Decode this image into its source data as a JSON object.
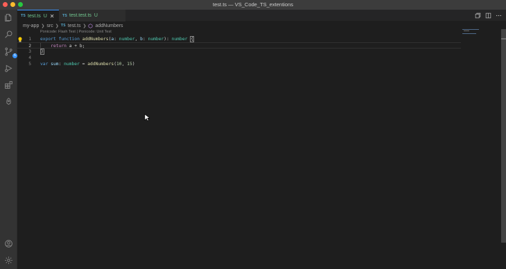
{
  "window": {
    "title": "test.ts — VS_Code_TS_extentions"
  },
  "activity_bar": {
    "items": [
      {
        "icon": "files-icon"
      },
      {
        "icon": "search-icon"
      },
      {
        "icon": "source-control-icon",
        "badge": "6"
      },
      {
        "icon": "run-debug-icon"
      },
      {
        "icon": "extensions-icon"
      },
      {
        "icon": "ponicode-icon"
      }
    ],
    "bottom_items": [
      {
        "icon": "account-icon"
      },
      {
        "icon": "settings-gear-icon"
      }
    ]
  },
  "tabs": [
    {
      "lang": "TS",
      "name": "test.ts",
      "status": "U",
      "active": true,
      "close": "✕"
    },
    {
      "lang": "TS",
      "name": "test.test.ts",
      "status": "U",
      "active": false
    }
  ],
  "breadcrumb": {
    "items": [
      "my-app",
      "src",
      "test.ts",
      "addNumbers"
    ],
    "ts_badge": "TS"
  },
  "editor": {
    "codelens": "Ponicode: Flash Test | Ponicode: Unit Test",
    "line_numbers": [
      "1",
      "2",
      "3",
      "4",
      "5"
    ],
    "active_line": "2",
    "lines": {
      "l1": {
        "export": "export",
        "function": "function",
        "name": "addNumbers",
        "open": "(",
        "a": "a",
        "colon1": ": ",
        "t1": "number",
        "comma": ", ",
        "b": "b",
        "colon2": ": ",
        "t2": "number",
        "close": "): ",
        "rt": "number",
        "brace": "{"
      },
      "l2": {
        "ret": "return",
        "expr": " a + b;"
      },
      "l3": {
        "brace": "}"
      },
      "l5": {
        "var": "var",
        "sum": "sum",
        "colon": ": ",
        "type": "number",
        "eq": " = ",
        "call": "addNumbers",
        "open": "(",
        "n1": "10",
        "comma": ", ",
        "n2": "15",
        "close": ")"
      }
    }
  },
  "colors": {
    "accent": "#3794ff",
    "untracked": "#73c991",
    "ts_blue": "#519aba"
  }
}
